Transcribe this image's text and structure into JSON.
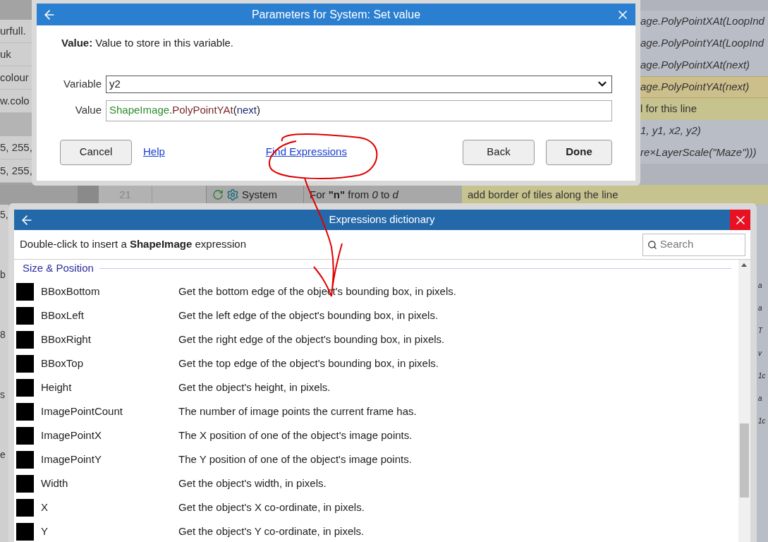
{
  "background": {
    "left_cells": [
      {
        "text": "urfull.",
        "kind": "text"
      },
      {
        "text": "uk",
        "kind": "text"
      },
      {
        "text": "colour",
        "kind": "text"
      },
      {
        "text": "w.colo",
        "kind": "text"
      },
      {
        "text": "",
        "kind": "band"
      },
      {
        "text": "5, 255,",
        "kind": "text"
      },
      {
        "text": "5, 255,",
        "kind": "text"
      }
    ],
    "right_cells": [
      {
        "text": "age.PolyPointXAt(LoopInd",
        "kind": "expression",
        "selected": false
      },
      {
        "text": "age.PolyPointYAt(LoopInd",
        "kind": "expression",
        "selected": false
      },
      {
        "text": "age.PolyPointXAt(next)",
        "kind": "expression",
        "selected": false
      },
      {
        "text": "age.PolyPointYAt(next)",
        "kind": "expression",
        "selected": true
      },
      {
        "text": "l for this line",
        "kind": "comment",
        "selected": false
      },
      {
        "text": "1, y1, x2, y2)",
        "kind": "expression",
        "selected": false
      },
      {
        "text": "re×LayerScale(\"Maze\")))",
        "kind": "expression",
        "selected": false
      }
    ],
    "event_row": {
      "line": "21",
      "object": "System",
      "condition": "For **\"n\"** from *0* to *d*",
      "comment": "add border of tiles along the line"
    },
    "lower_left": [
      {
        "text": "5,"
      },
      {
        "text": "b"
      },
      {
        "text": "8"
      },
      {
        "text": "s"
      },
      {
        "text": "e"
      }
    ],
    "lower_right": [
      {
        "text": "a"
      },
      {
        "text": "a"
      },
      {
        "text": "T"
      },
      {
        "text": "v"
      },
      {
        "text": "1c"
      },
      {
        "text": "a"
      },
      {
        "text": "1c"
      }
    ]
  },
  "dialog": {
    "title": "Parameters for System: Set value",
    "description": "**Value:** Value to store in this variable.",
    "fields": [
      {
        "label": "Variable",
        "kind": "dropdown",
        "value": "y2"
      },
      {
        "label": "Value",
        "kind": "expression",
        "tokens": [
          {
            "text": "ShapeImage",
            "kind": "object"
          },
          {
            "text": ".",
            "kind": "punct"
          },
          {
            "text": "PolyPointYAt",
            "kind": "method"
          },
          {
            "text": "(",
            "kind": "punct"
          },
          {
            "text": "next",
            "kind": "param"
          },
          {
            "text": ")",
            "kind": "punct"
          }
        ]
      }
    ],
    "buttons": [
      {
        "label": "Cancel",
        "kind": "button"
      },
      {
        "label": "Help",
        "kind": "link"
      },
      {
        "label": "Find Expressions",
        "kind": "link"
      },
      {
        "label": "Back",
        "kind": "button"
      },
      {
        "label": "Done",
        "kind": "primary"
      }
    ]
  },
  "dictionary": {
    "title": "Expressions dictionary",
    "hint": "Double-click to insert a **ShapeImage** expression",
    "search": {
      "placeholder": "Search"
    },
    "section": "Size & Position",
    "items": [
      {
        "name": "BBoxBottom",
        "description": "Get the bottom edge of the object's bounding box, in pixels."
      },
      {
        "name": "BBoxLeft",
        "description": "Get the left edge of the object's bounding box, in pixels."
      },
      {
        "name": "BBoxRight",
        "description": "Get the right edge of the object's bounding box, in pixels."
      },
      {
        "name": "BBoxTop",
        "description": "Get the top edge of the object's bounding box, in pixels."
      },
      {
        "name": "Height",
        "description": "Get the object's height, in pixels."
      },
      {
        "name": "ImagePointCount",
        "description": "The number of image points the current frame has."
      },
      {
        "name": "ImagePointX",
        "description": "The X position of one of the object's image points."
      },
      {
        "name": "ImagePointY",
        "description": "The Y position of one of the object's image points."
      },
      {
        "name": "Width",
        "description": "Get the object's width, in pixels."
      },
      {
        "name": "X",
        "description": "Get the object's X co-ordinate, in pixels."
      },
      {
        "name": "Y",
        "description": "Get the object's Y co-ordinate, in pixels."
      }
    ]
  }
}
